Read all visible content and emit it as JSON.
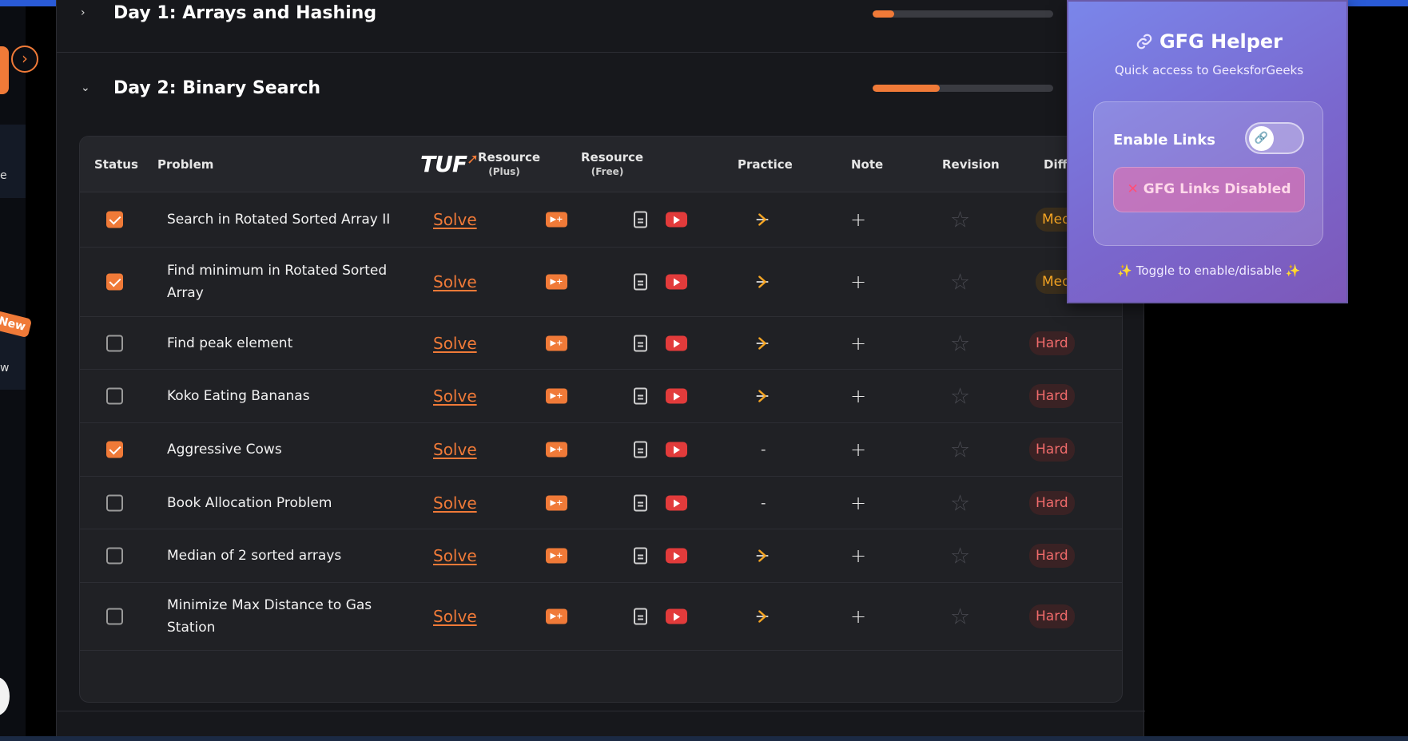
{
  "sidebar": {
    "toggle_icon": "chevron-right-icon",
    "panel1_text": "e",
    "new_badge": "New",
    "panel2_text": "w"
  },
  "days": [
    {
      "chevron": "›",
      "title": "Day 1: Arrays and Hashing",
      "progress": 0.12
    },
    {
      "chevron": "⌄",
      "title": "Day 2: Binary Search",
      "progress": 0.37
    }
  ],
  "table": {
    "headers": {
      "status": "Status",
      "problem": "Problem",
      "tuf": "TUF",
      "resource_plus": "Resource",
      "resource_plus_sub": "(Plus)",
      "resource_free": "Resource",
      "resource_free_sub": "(Free)",
      "practice": "Practice",
      "note": "Note",
      "revision": "Revision",
      "difficulty": "Diffi"
    },
    "rows": [
      {
        "done": true,
        "name": "Search in Rotated Sorted Array II",
        "solve": "Solve",
        "practice": "gfg",
        "difficulty": "Med",
        "level": "med"
      },
      {
        "done": true,
        "name": "Find minimum in Rotated Sorted Array",
        "solve": "Solve",
        "practice": "gfg",
        "difficulty": "Med",
        "level": "med"
      },
      {
        "done": false,
        "name": "Find peak element",
        "solve": "Solve",
        "practice": "gfg",
        "difficulty": "Hard",
        "level": "hard"
      },
      {
        "done": false,
        "name": "Koko Eating Bananas",
        "solve": "Solve",
        "practice": "gfg",
        "difficulty": "Hard",
        "level": "hard"
      },
      {
        "done": true,
        "name": "Aggressive Cows",
        "solve": "Solve",
        "practice": "-",
        "difficulty": "Hard",
        "level": "hard"
      },
      {
        "done": false,
        "name": "Book Allocation Problem",
        "solve": "Solve",
        "practice": "-",
        "difficulty": "Hard",
        "level": "hard"
      },
      {
        "done": false,
        "name": "Median of 2 sorted arrays",
        "solve": "Solve",
        "practice": "gfg",
        "difficulty": "Hard",
        "level": "hard"
      },
      {
        "done": false,
        "name": "Minimize Max Distance to Gas Station",
        "solve": "Solve",
        "practice": "gfg",
        "difficulty": "Hard",
        "level": "hard"
      }
    ],
    "note_symbol": "+",
    "revision_symbol": "☆",
    "plus_resource_symbol": "▶+"
  },
  "popup": {
    "title": "GFG Helper",
    "subtitle": "Quick access to GeeksforGeeks",
    "enable_label": "Enable Links",
    "toggle_on": false,
    "status_label": "GFG Links Disabled",
    "status_icon": "❌",
    "footer": "✨ Toggle to enable/disable ✨"
  },
  "colors": {
    "accent": "#f07a38",
    "hard": "#f06b6b",
    "medium": "#f5a524",
    "popup_gradient_start": "#7a86ea",
    "popup_gradient_end": "#7d58b9"
  }
}
